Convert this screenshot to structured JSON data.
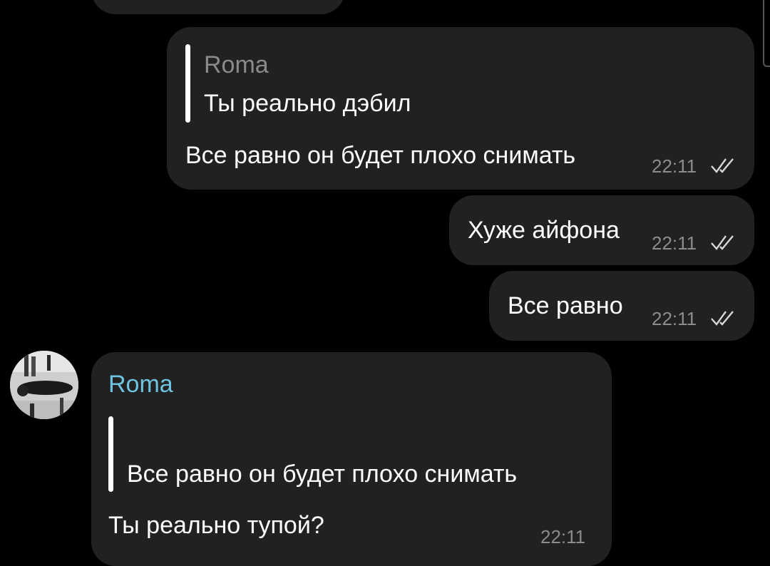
{
  "messages": [
    {
      "reply_to": {
        "name": "Roma",
        "text": "Ты реально дэбил"
      },
      "text": "Все равно он будет плохо снимать",
      "time": "22:11"
    },
    {
      "text": "Хуже айфона",
      "time": "22:11"
    },
    {
      "text": "Все равно",
      "time": "22:11"
    },
    {
      "sender": "Roma",
      "reply_to": {
        "text": "Все равно он будет плохо снимать"
      },
      "text": "Ты реально тупой?",
      "time": "22:11"
    }
  ],
  "colors": {
    "background": "#000000",
    "bubble": "#212121",
    "sender_name": "#6ec4e0",
    "time": "#8c8c8c"
  },
  "icons": [
    "double-check-icon",
    "avatar"
  ]
}
